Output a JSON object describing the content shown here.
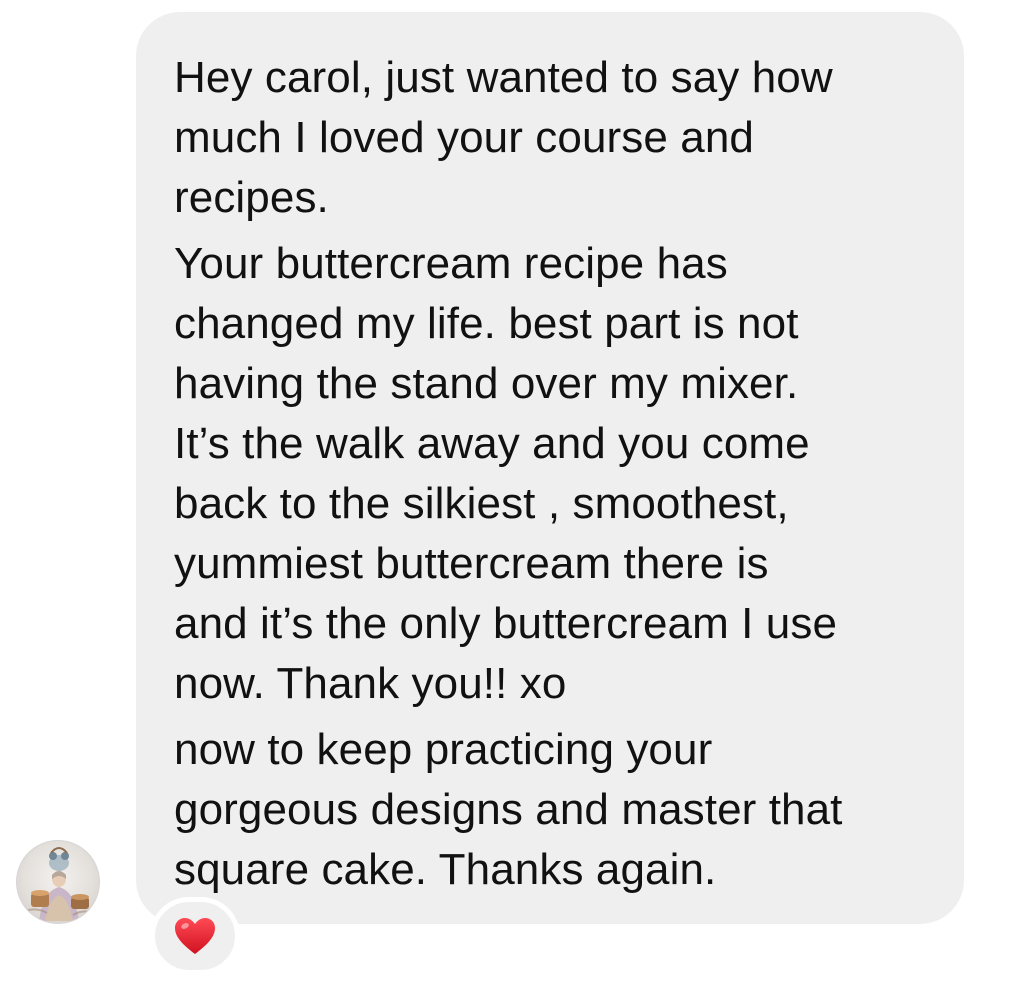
{
  "message": {
    "paragraphs": [
      {
        "lines": [
          "Hey carol, just wanted to say how",
          "much I loved your course and",
          "recipes."
        ]
      },
      {
        "lines": [
          "Your buttercream recipe has",
          "changed my life. best part is not",
          "having the stand over my mixer.",
          "It’s the walk away and you come",
          "back to the silkiest , smoothest,",
          "yummiest buttercream there is",
          "and it’s the only buttercream I use",
          "now. Thank you!! xo"
        ]
      },
      {
        "lines": [
          "now to keep practicing your",
          "gorgeous designs and master that",
          "square cake. Thanks again."
        ]
      }
    ]
  },
  "sender": {
    "avatar_icon": "profile-photo"
  },
  "reaction": {
    "icon": "red-heart-icon",
    "color": "#e8192c"
  },
  "colors": {
    "bubble": "#efefef",
    "text": "#111111",
    "background": "#ffffff"
  }
}
